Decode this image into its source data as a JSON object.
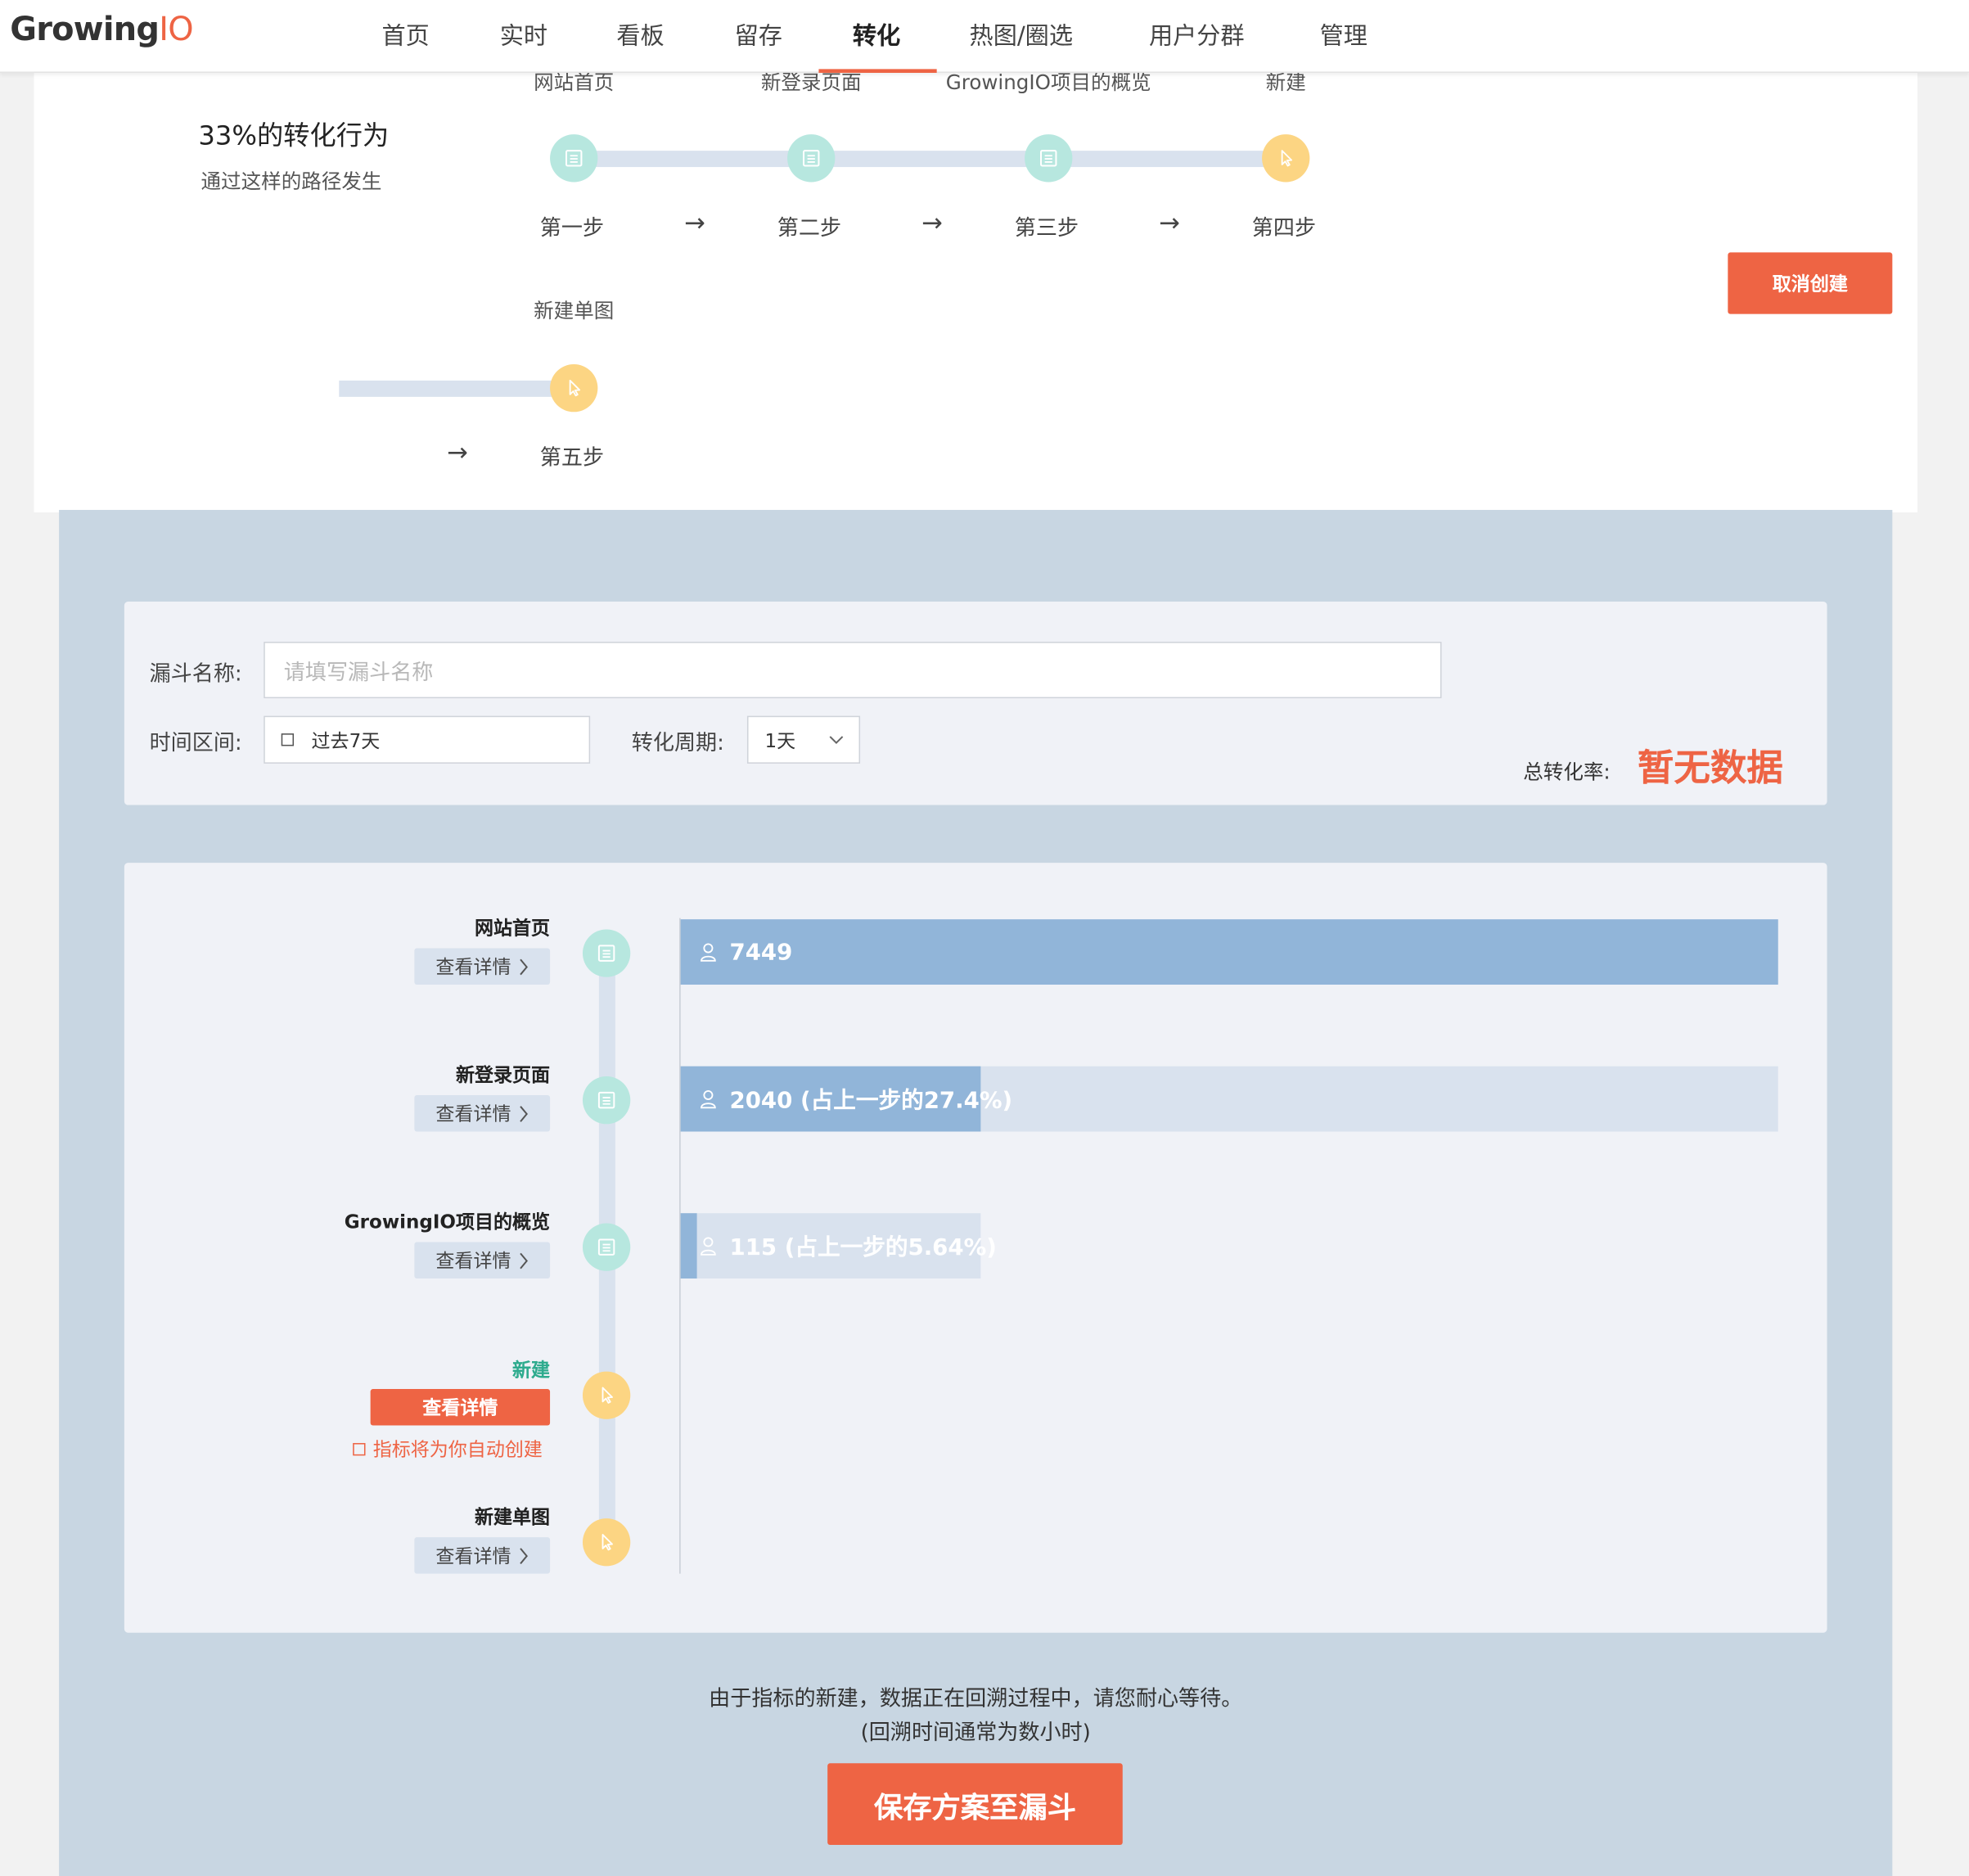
{
  "logo": {
    "text_main": "Growing",
    "text_accent": "IO"
  },
  "nav": {
    "items": [
      {
        "label": "首页"
      },
      {
        "label": "实时"
      },
      {
        "label": "看板"
      },
      {
        "label": "留存"
      },
      {
        "label": "转化"
      },
      {
        "label": "热图/圈选"
      },
      {
        "label": "用户分群"
      },
      {
        "label": "管理"
      }
    ],
    "active": "转化"
  },
  "path_summary": {
    "title": "33%的转化行为",
    "subtitle": "通过这样的路径发生",
    "steps": [
      {
        "name": "网站首页",
        "label": "第一步",
        "type": "page"
      },
      {
        "name": "新登录页面",
        "label": "第二步",
        "type": "page"
      },
      {
        "name": "GrowingIO项目的概览",
        "label": "第三步",
        "type": "page"
      },
      {
        "name": "新建",
        "label": "第四步",
        "type": "click"
      },
      {
        "name": "新建单图",
        "label": "第五步",
        "type": "click"
      }
    ],
    "arrow": "→"
  },
  "cancel_button": "取消创建",
  "form": {
    "name_label": "漏斗名称:",
    "name_placeholder": "请填写漏斗名称",
    "time_label": "时间区间:",
    "time_value": "过去7天",
    "period_label": "转化周期:",
    "period_value": "1天",
    "total_label": "总转化率:",
    "total_value": "暂无数据"
  },
  "funnel": {
    "detail_label": "查看详情",
    "steps": [
      {
        "name": "网站首页",
        "bar_text": "7449",
        "users": 7449
      },
      {
        "name": "新登录页面",
        "bar_text": "2040 (占上一步的27.4%)",
        "users": 2040,
        "pct_of_prev": 27.4
      },
      {
        "name": "GrowingIO项目的概览",
        "bar_text": "115 (占上一步的5.64%)",
        "users": 115,
        "pct_of_prev": 5.64
      },
      {
        "name": "新建",
        "auto_note": "指标将为你自动创建"
      },
      {
        "name": "新建单图"
      }
    ]
  },
  "footnote": {
    "line1": "由于指标的新建，数据正在回溯过程中，请您耐心等待。",
    "line2": "(回溯时间通常为数小时)"
  },
  "save_button": "保存方案至漏斗",
  "colors": {
    "accent": "#ee6444",
    "page_node": "#b7e7df",
    "click_node": "#fcd583",
    "bar": "#91b5d9",
    "track": "#d9e2ee",
    "section_bg": "#c8d6e2"
  }
}
